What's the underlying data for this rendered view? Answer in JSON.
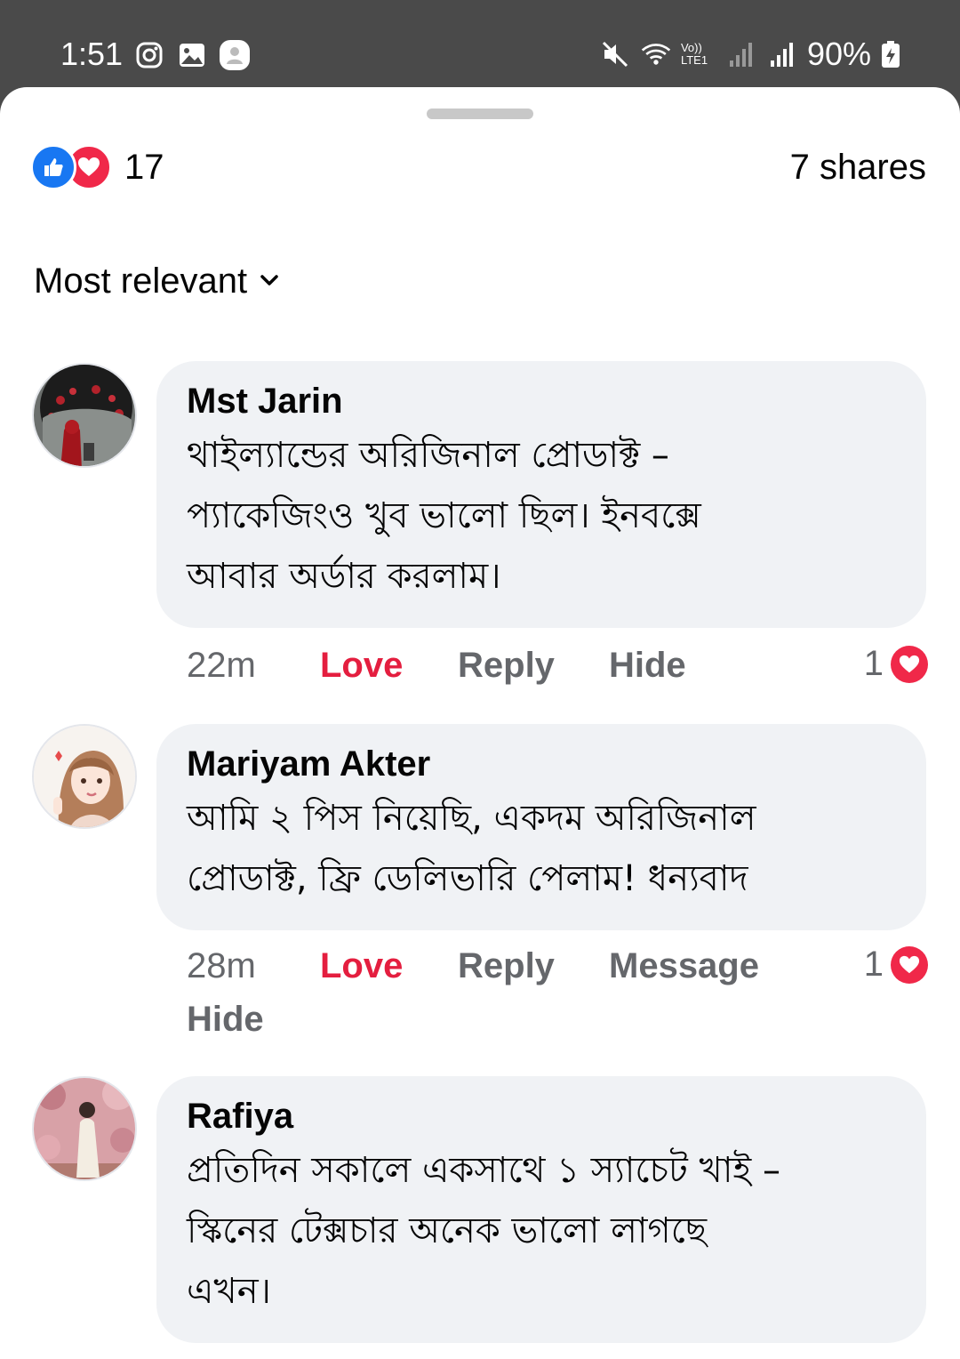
{
  "status_bar": {
    "time": "1:51",
    "battery": "90%",
    "network_label": "Vo)) LTE1"
  },
  "post_stats": {
    "reaction_count": "17",
    "shares": "7 shares"
  },
  "sort": {
    "label": "Most relevant"
  },
  "comments": [
    {
      "author": "Mst Jarin",
      "text": "থাইল্যান্ডের অরিজিনাল প্রোডাক্ট –\nপ্যাকেজিংও খুব ভালো ছিল। ইনবক্সে\nআবার অর্ডার করলাম।",
      "time": "22m",
      "love": "Love",
      "reply": "Reply",
      "extra1": "Hide",
      "reactions": "1"
    },
    {
      "author": "Mariyam Akter",
      "text": "আমি ২ পিস নিয়েছি, একদম অরিজিনাল\nপ্রোডাক্ট, ফ্রি ডেলিভারি পেলাম! ধন্যবাদ",
      "time": "28m",
      "love": "Love",
      "reply": "Reply",
      "extra1": "Message",
      "extra2": "Hide",
      "reactions": "1"
    },
    {
      "author": "Rafiya",
      "text": "প্রতিদিন সকালে একসাথে ১ স্যাচেট খাই –\nস্কিনের টেক্সচার অনেক ভালো লাগছে\nএখন।"
    }
  ],
  "colors": {
    "like_blue": "#1877f2",
    "love_red": "#f02849",
    "love_text": "#e41e3f",
    "bubble_bg": "#f0f2f5",
    "secondary_text": "#65676b"
  }
}
